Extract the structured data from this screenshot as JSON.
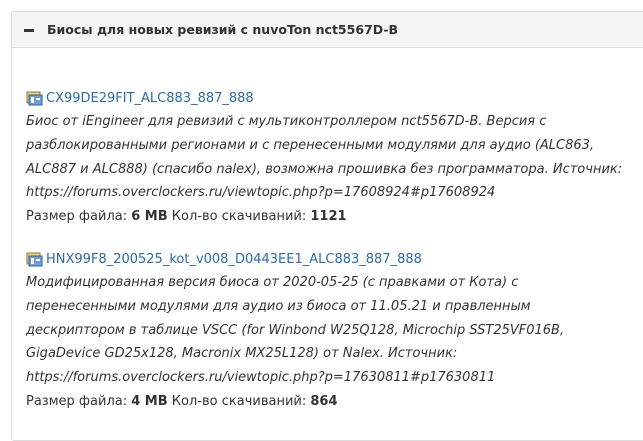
{
  "section": {
    "title": "Биосы для новых ревизий с nuvoTon nct5567D-B",
    "collapse_icon": "minus-icon"
  },
  "labels": {
    "size": "Размер файла:",
    "downloads": "Кол-во скачиваний:"
  },
  "files": [
    {
      "name": "CX99DE29FIT_ALC883_887_888",
      "icon": "archive-file-icon",
      "description": "Биос от iEngineer для ревизий с мультиконтроллером nct5567D-B. Версия с разблокированными регионами и с перенесенными модулями для аудио (ALC863, ALC887 и ALC888) (спасибо nalex), возможна прошивка без программатора. Источник: https://forums.overclockers.ru/viewtopic.php?p=17608924#p17608924",
      "size": "6 MB",
      "downloads": "1121"
    },
    {
      "name": "HNX99F8_200525_kot_v008_D0443EE1_ALC883_887_888",
      "icon": "archive-file-icon",
      "description": "Модифицированная версия биоса от 2020-05-25 (с правками от Кота) с перенесенными модулями для аудио из биоса от 11.05.21 и правленным дескриптором в таблице VSCC (for Winbond W25Q128, Microchip SST25VF016B, GigaDevice GD25x128, Macronix MX25L128) от Nalex. Источник: https://forums.overclockers.ru/viewtopic.php?p=17630811#p17630811",
      "size": "4 MB",
      "downloads": "864"
    }
  ]
}
